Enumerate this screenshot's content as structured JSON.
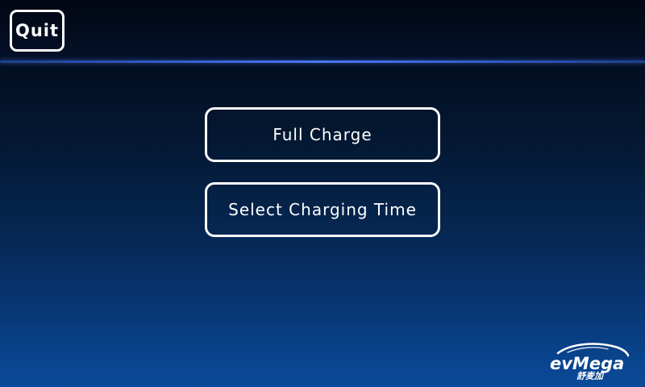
{
  "header": {
    "quit_label": "Quit"
  },
  "menu": {
    "items": [
      {
        "label": "Full Charge"
      },
      {
        "label": "Select Charging Time"
      }
    ]
  },
  "logo": {
    "text": "evMega",
    "subtext": "舒麦加",
    "icon": "car-silhouette-icon"
  },
  "colors": {
    "background_top": "#030a16",
    "background_bottom": "#0a4a9a",
    "header_line": "#4a78ff",
    "text": "#ffffff"
  }
}
